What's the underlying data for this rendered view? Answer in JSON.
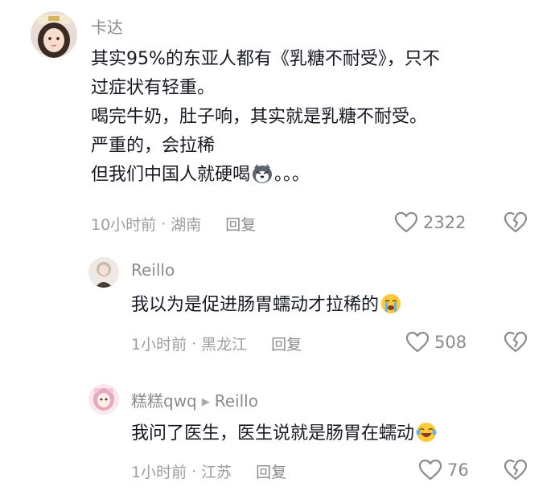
{
  "comments": [
    {
      "author": "卡达",
      "lines": [
        "其实95%的东亚人都有《乳糖不耐受》，只不",
        "过症状有轻重。",
        "喝完牛奶，肚子响，其实就是乳糖不耐受。",
        "严重的，会拉稀",
        "但我们中国人就硬喝"
      ],
      "line_tail": "。。。",
      "time": "10小时前",
      "location": "湖南",
      "reply_label": "回复",
      "likes": "2322",
      "emoji_name": "husky-emoji"
    },
    {
      "author": "Reillo",
      "text": "我以为是促进肠胃蠕动才拉稀的",
      "time": "1小时前",
      "location": "黑龙江",
      "reply_label": "回复",
      "likes": "508",
      "emoji_name": "crying-emoji"
    },
    {
      "author": "糕糕qwq",
      "reply_to": "Reillo",
      "text": "我问了医生，医生说就是肠胃在蠕动",
      "time": "1小时前",
      "location": "江苏",
      "reply_label": "回复",
      "likes": "76",
      "emoji_name": "laugh-cry-emoji"
    }
  ],
  "separator": "·",
  "colors": {
    "text": "#161823",
    "meta": "#9c9da3",
    "name": "#8a8b91"
  }
}
